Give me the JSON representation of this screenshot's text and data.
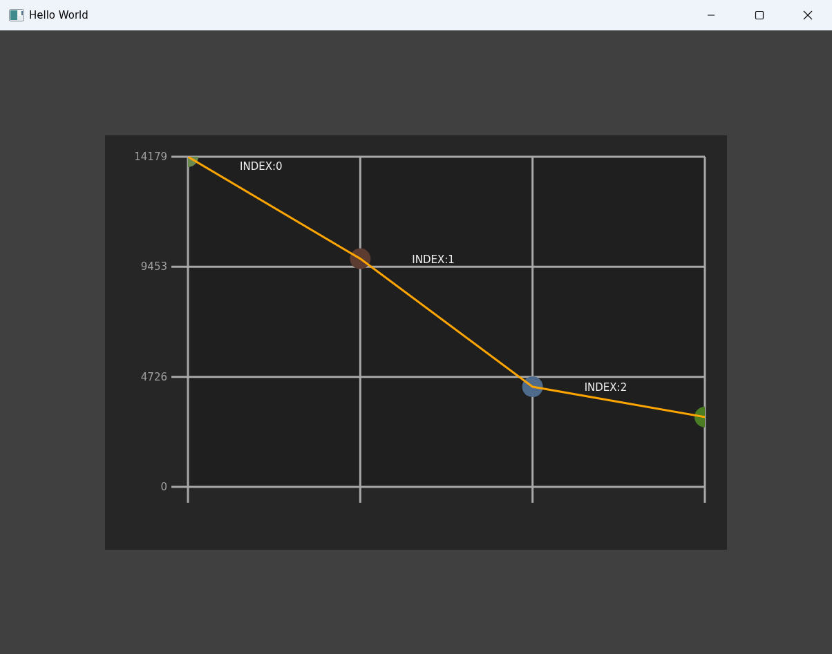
{
  "window": {
    "title": "Hello World"
  },
  "chart": {
    "chart_data": {
      "type": "line",
      "grid": true,
      "ylim": [
        0,
        14179
      ],
      "yticks": [
        0,
        4726,
        9453,
        14179
      ],
      "series": [
        {
          "color": "#ffa500",
          "marker": "circle",
          "values": [
            14179,
            9800,
            4300,
            3000
          ]
        }
      ],
      "annotations": [
        "INDEX:0",
        "INDEX:1",
        "INDEX:2"
      ]
    },
    "points": [
      {
        "color": "#6b8a4e"
      },
      {
        "color": "#5c3b30"
      },
      {
        "color": "#4e6b8c"
      },
      {
        "color": "#4b7d25"
      }
    ]
  }
}
